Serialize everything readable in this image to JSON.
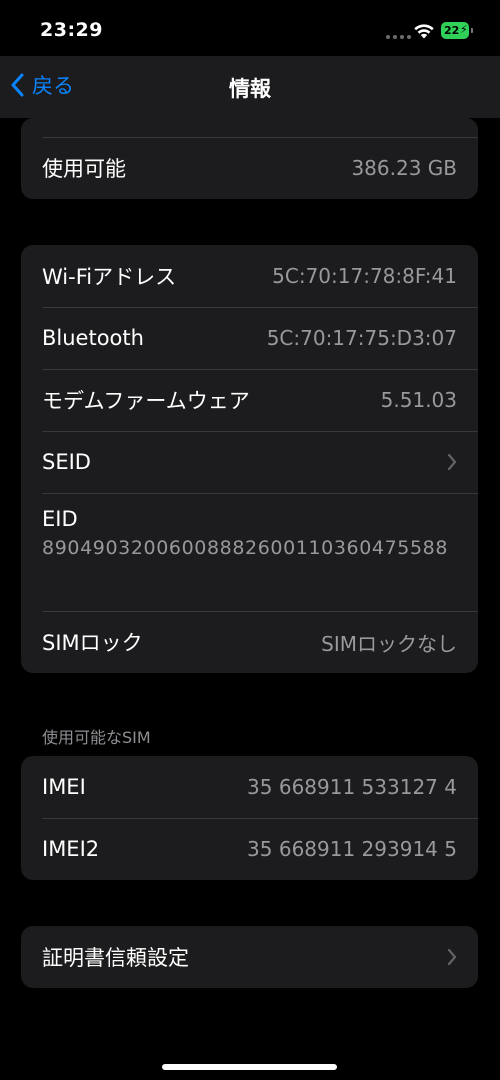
{
  "status": {
    "time": "23:29",
    "battery_level": "22"
  },
  "nav": {
    "back_label": "戻る",
    "title": "情報"
  },
  "storage": {
    "available_label": "使用可能",
    "available_value": "386.23 GB"
  },
  "network": {
    "rows": [
      {
        "label": "Wi-Fiアドレス",
        "value": "5C:70:17:78:8F:41"
      },
      {
        "label": "Bluetooth",
        "value": "5C:70:17:75:D3:07"
      },
      {
        "label": "モデムファームウェア",
        "value": "5.51.03"
      },
      {
        "label": "SEID"
      },
      {
        "label": "EID",
        "value": "89049032006008882600110360475588"
      },
      {
        "label": "SIMロック",
        "value": "SIMロックなし"
      }
    ]
  },
  "sim_section": {
    "header": "使用可能なSIM",
    "rows": [
      {
        "label": "IMEI",
        "value": "35 668911 533127 4"
      },
      {
        "label": "IMEI2",
        "value": "35 668911 293914 5"
      }
    ]
  },
  "certificates": {
    "label": "証明書信頼設定"
  },
  "colors": {
    "accent": "#0a84ff",
    "battery": "#30d158",
    "background": "#000000",
    "card": "#1c1c1e"
  }
}
